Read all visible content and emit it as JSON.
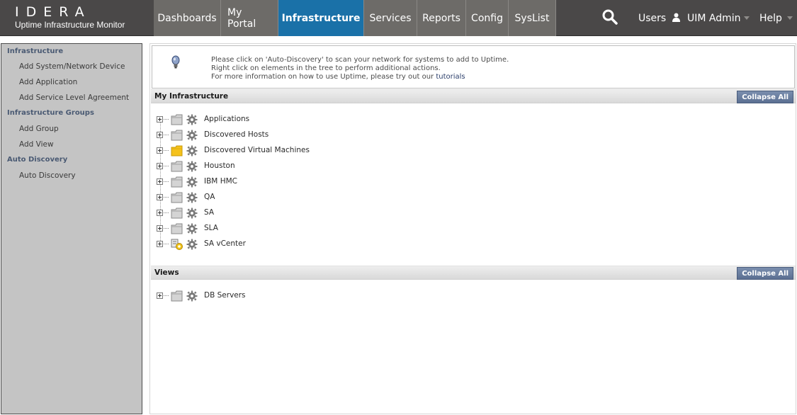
{
  "header": {
    "logo_text": "IDERA",
    "app_title": "Uptime Infrastructure Monitor",
    "nav": [
      {
        "label": "Dashboards"
      },
      {
        "label": "My Portal"
      },
      {
        "label": "Infrastructure",
        "active": true
      },
      {
        "label": "Services"
      },
      {
        "label": "Reports"
      },
      {
        "label": "Config"
      },
      {
        "label": "SysList"
      }
    ],
    "users_label": "Users",
    "user_name": "UIM Admin",
    "help_label": "Help",
    "colors": {
      "bar": "#4a4848",
      "tab": "#6d6b68",
      "active_tab": "#1a71a8"
    }
  },
  "sidebar": {
    "sections": [
      {
        "title": "Infrastructure",
        "items": [
          "Add System/Network Device",
          "Add Application",
          "Add Service Level Agreement"
        ]
      },
      {
        "title": "Infrastructure Groups",
        "items": [
          "Add Group",
          "Add View"
        ]
      },
      {
        "title": "Auto Discovery",
        "items": [
          "Auto Discovery"
        ]
      }
    ]
  },
  "info": {
    "line1": "Please click on 'Auto-Discovery' to scan your network for systems to add to Uptime.",
    "line2": "Right click on elements in the tree to perform additional actions.",
    "line3_prefix": "For more information on how to use Uptime, please try out our ",
    "line3_link": "tutorials"
  },
  "my_infrastructure": {
    "title": "My Infrastructure",
    "collapse_label": "Collapse All",
    "items": [
      {
        "label": "Applications",
        "icon": "folder-icon"
      },
      {
        "label": "Discovered Hosts",
        "icon": "folder-icon"
      },
      {
        "label": "Discovered Virtual Machines",
        "icon": "folder-open-yellow-icon"
      },
      {
        "label": "Houston",
        "icon": "folder-icon"
      },
      {
        "label": "IBM HMC",
        "icon": "folder-icon"
      },
      {
        "label": "QA",
        "icon": "folder-icon"
      },
      {
        "label": "SA",
        "icon": "folder-icon"
      },
      {
        "label": "SLA",
        "icon": "folder-icon"
      },
      {
        "label": "SA vCenter",
        "icon": "vcenter-icon"
      }
    ]
  },
  "views": {
    "title": "Views",
    "collapse_label": "Collapse All",
    "items": [
      {
        "label": "DB Servers",
        "icon": "folder-icon"
      }
    ]
  }
}
